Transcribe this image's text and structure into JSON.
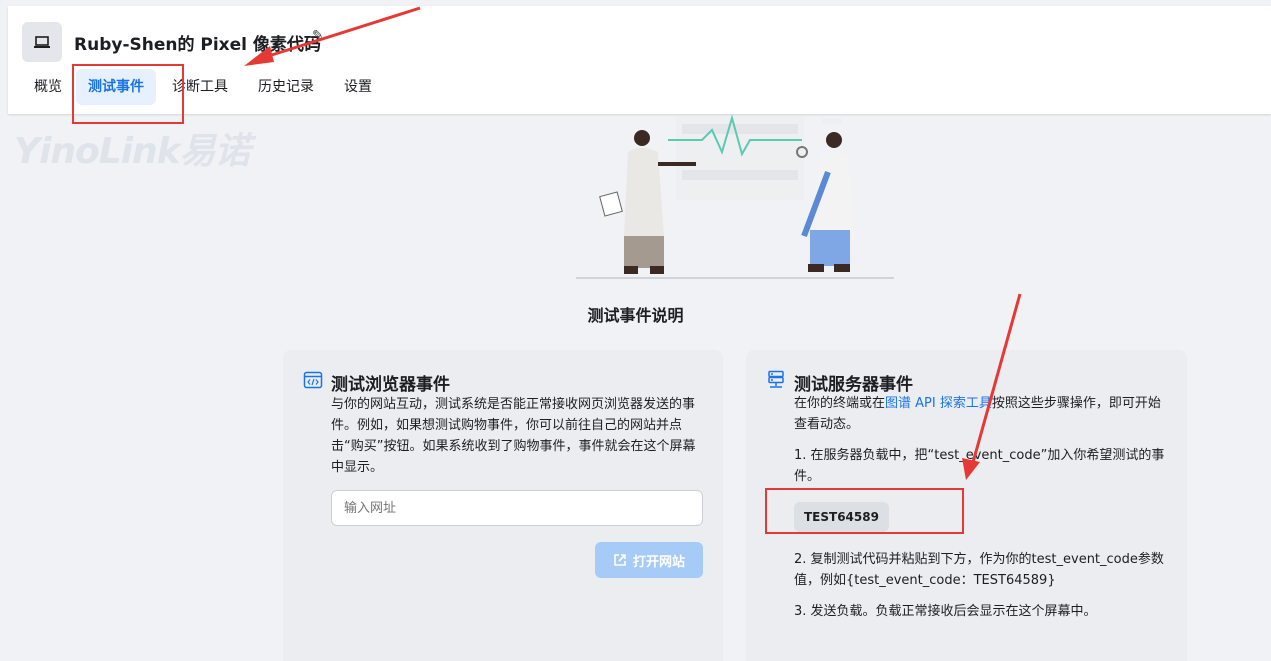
{
  "header": {
    "title": "Ruby-Shen的 Pixel 像素代码",
    "tabs": [
      {
        "label": "概览"
      },
      {
        "label": "测试事件",
        "active": true
      },
      {
        "label": "诊断工具"
      },
      {
        "label": "历史记录"
      },
      {
        "label": "设置"
      }
    ]
  },
  "watermark": "YinoLink易诺",
  "section_title": "测试事件说明",
  "browser_card": {
    "title": "测试浏览器事件",
    "description": "与你的网站互动，测试系统是否能正常接收网页浏览器发送的事件。例如，如果想测试购物事件，你可以前往自己的网站并点击“购买”按钮。如果系统收到了购物事件，事件就会在这个屏幕中显示。",
    "url_placeholder": "输入网址",
    "open_button": "打开网站"
  },
  "server_card": {
    "title": "测试服务器事件",
    "intro_before": "在你的终端或在",
    "intro_link": "图谱 API 探索工具",
    "intro_after": "按照这些步骤操作，即可开始查看动态。",
    "step1": "1. 在服务器负载中，把“test_event_code”加入你希望测试的事件。",
    "test_code": "TEST64589",
    "step2": "2. 复制测试代码并粘贴到下方，作为你的test_event_code参数值，例如{test_event_code：TEST64589}",
    "step3": "3. 发送负载。负载正常接收后会显示在这个屏幕中。"
  },
  "colors": {
    "accent": "#1b74e4",
    "annotation": "#e53935"
  }
}
